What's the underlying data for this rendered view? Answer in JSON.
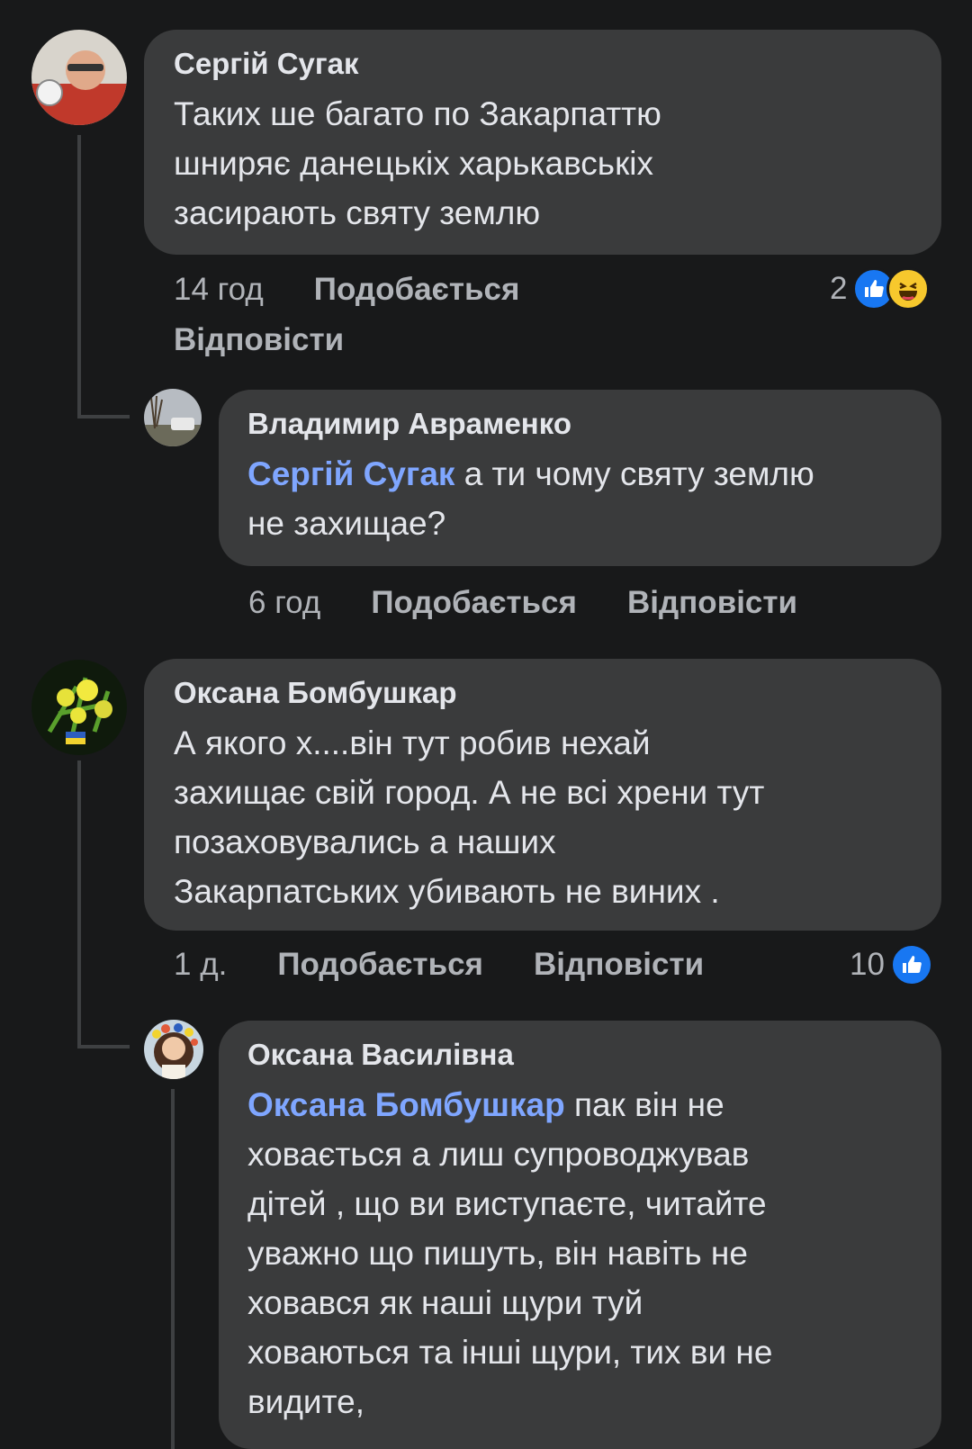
{
  "comments": [
    {
      "author": "Сергій Сугак",
      "text_lines": [
        "Таких ше багато по Закарпаттю",
        "шниряє данецькіх харькавськіх",
        "засирають святу землю"
      ],
      "time": "14 год",
      "like_label": "Подобається",
      "reply_label": "Відповісти",
      "reaction_count": "2",
      "reaction_icons": [
        "like-icon",
        "haha-icon"
      ]
    },
    {
      "author": "Владимир Авраменко",
      "mention": "Сергій Сугак",
      "text_first": " а ти чому святу землю",
      "text_lines": [
        "не захищае?"
      ],
      "time": "6 год",
      "like_label": "Подобається",
      "reply_label": "Відповісти"
    },
    {
      "author": "Оксана Бомбушкар",
      "text_lines": [
        "А якого х....він тут робив нехай",
        "захищає свій город. А не всі хрени тут",
        "позаховувались а наших",
        "Закарпатських убивають не виних ."
      ],
      "time": "1 д.",
      "like_label": "Подобається",
      "reply_label": "Відповісти",
      "reaction_count": "10",
      "reaction_icons": [
        "like-icon"
      ]
    },
    {
      "author": "Оксана Василівна",
      "mention": "Оксана Бомбушкар",
      "text_first": " пак він не",
      "text_lines": [
        "ховається а лиш супроводжував",
        "дітей , що ви виступаєте, читайте",
        "уважно що пишуть, він навіть не",
        "ховався як наші щури туй",
        "ховаються та інші щури, тих ви не",
        "видите,"
      ]
    }
  ],
  "colors": {
    "background": "#18191a",
    "bubble": "#3a3b3c",
    "mention": "#7fa6ff",
    "like_blue": "#1877f2"
  }
}
